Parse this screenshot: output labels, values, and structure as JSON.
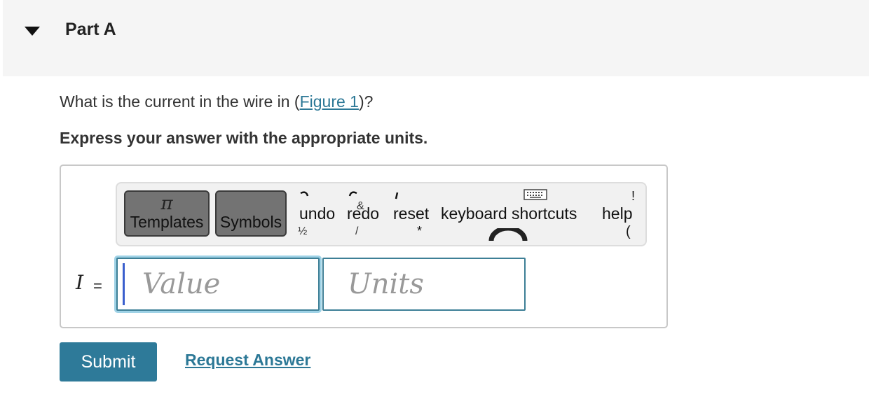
{
  "part": {
    "title": "Part A",
    "toggle_icon": "triangle-down-icon"
  },
  "question": {
    "prefix": "What is the current in the wire in (",
    "link_text": "Figure 1",
    "suffix": ")?"
  },
  "instruction": "Express your answer with the appropriate units.",
  "toolbar": {
    "templates": {
      "label": "Templates",
      "icon": "π"
    },
    "symbols": {
      "label": "Symbols",
      "icon": ""
    },
    "undo": "undo",
    "redo": "redo",
    "reset": "reset",
    "keyboard_shortcuts": "keyboard shortcuts",
    "help": "help"
  },
  "answer": {
    "variable": "I",
    "equals": "=",
    "value_placeholder": "Value",
    "units_placeholder": "Units"
  },
  "actions": {
    "submit": "Submit",
    "request_answer": "Request Answer"
  },
  "colors": {
    "accent": "#2e7a99",
    "link": "#2c7896",
    "header_bg": "#f5f5f5",
    "toolbar_button": "#737373"
  }
}
